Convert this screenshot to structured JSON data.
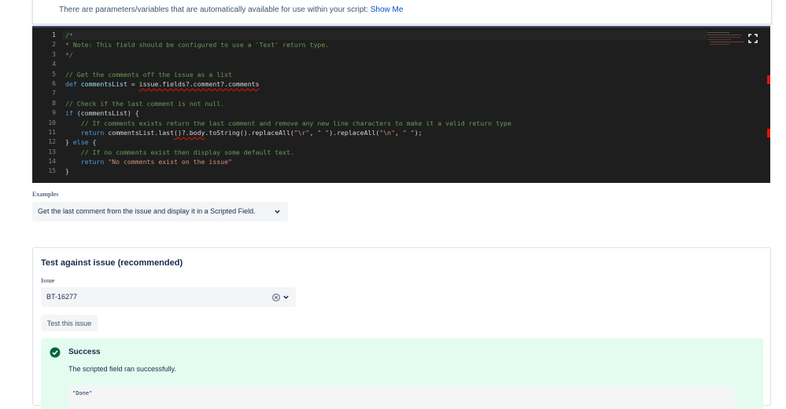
{
  "info": {
    "text": "There are parameters/variables that are automatically available for use within your script:",
    "link": "Show Me"
  },
  "editor": {
    "line_numbers": [
      "1",
      "2",
      "3",
      "4",
      "5",
      "6",
      "7",
      "8",
      "9",
      "10",
      "11",
      "12",
      "13",
      "14",
      "15"
    ],
    "lines": [
      [
        {
          "t": "c",
          "v": "/*"
        }
      ],
      [
        {
          "t": "c",
          "v": "* Note: This field should be configured to use a 'Text' return type."
        }
      ],
      [
        {
          "t": "c",
          "v": "*/"
        }
      ],
      [],
      [
        {
          "t": "c",
          "v": "// Get the comments off the issue as a list"
        }
      ],
      [
        {
          "t": "k",
          "v": "def "
        },
        {
          "t": "v",
          "v": "commentsList"
        },
        {
          "t": "p",
          "v": " = "
        },
        {
          "t": "sq",
          "v": "issue.fields?.comment?.comments"
        }
      ],
      [],
      [
        {
          "t": "c",
          "v": "// Check if the last comment is not null."
        }
      ],
      [
        {
          "t": "k",
          "v": "if"
        },
        {
          "t": "p",
          "v": " (commentsList) {"
        }
      ],
      [
        {
          "t": "p",
          "v": "    "
        },
        {
          "t": "c",
          "v": "// If comments exists return the last comment and remove any new line characters to make it a valid return type"
        }
      ],
      [
        {
          "t": "p",
          "v": "    "
        },
        {
          "t": "k",
          "v": "return"
        },
        {
          "t": "p",
          "v": " commentsList.last"
        },
        {
          "t": "sq",
          "v": "()?.body"
        },
        {
          "t": "p",
          "v": ".toString().replaceAll("
        },
        {
          "t": "s",
          "v": "\"\\r\""
        },
        {
          "t": "p",
          "v": ", "
        },
        {
          "t": "s",
          "v": "\" \""
        },
        {
          "t": "p",
          "v": ").replaceAll("
        },
        {
          "t": "s",
          "v": "\"\\n\""
        },
        {
          "t": "p",
          "v": ", "
        },
        {
          "t": "s",
          "v": "\" \""
        },
        {
          "t": "p",
          "v": ");"
        }
      ],
      [
        {
          "t": "p",
          "v": "} "
        },
        {
          "t": "k",
          "v": "else"
        },
        {
          "t": "p",
          "v": " {"
        }
      ],
      [
        {
          "t": "p",
          "v": "    "
        },
        {
          "t": "c",
          "v": "// If no comments exist then display some default text."
        }
      ],
      [
        {
          "t": "p",
          "v": "    "
        },
        {
          "t": "k",
          "v": "return"
        },
        {
          "t": "p",
          "v": " "
        },
        {
          "t": "s",
          "v": "\"No comments exist on the issue\""
        }
      ],
      [
        {
          "t": "p",
          "v": "}"
        }
      ]
    ],
    "colors": {
      "background": "#1e1e1e",
      "comment": "#6a9955",
      "keyword": "#569cd6",
      "string": "#ce9178",
      "error": "#e51400"
    }
  },
  "examples": {
    "label": "Examples",
    "selected": "Get the last comment from the issue and display it in a Scripted Field."
  },
  "test": {
    "title": "Test against issue (recommended)",
    "issue_label": "Issue",
    "issue_value": "BT-16277",
    "button": "Test this issue",
    "success_title": "Success",
    "success_message": "The scripted field ran successfully.",
    "result": "\"Done\""
  }
}
